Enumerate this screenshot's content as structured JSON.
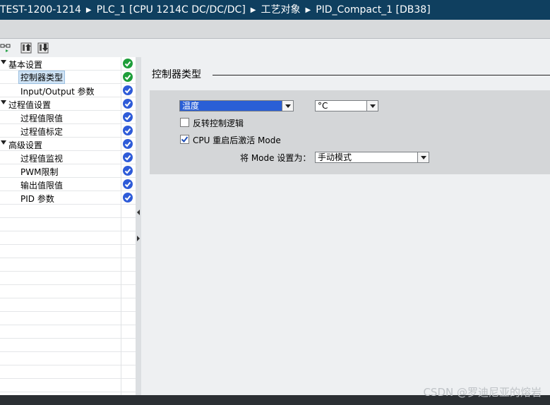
{
  "breadcrumb": [
    "TEST-1200-1214",
    "PLC_1 [CPU 1214C DC/DC/DC]",
    "工艺对象",
    "PID_Compact_1 [DB38]"
  ],
  "icons": {
    "toolbar": [
      "network-view-icon",
      "upload-icon",
      "download-icon"
    ]
  },
  "tree": [
    {
      "label": "基本设置",
      "level": 0,
      "status": "ok"
    },
    {
      "label": "控制器类型",
      "level": 1,
      "status": "ok",
      "selected": true
    },
    {
      "label": "Input/Output 参数",
      "level": 1,
      "status": "info"
    },
    {
      "label": "过程值设置",
      "level": 0,
      "status": "info"
    },
    {
      "label": "过程值限值",
      "level": 1,
      "status": "info"
    },
    {
      "label": "过程值标定",
      "level": 1,
      "status": "info"
    },
    {
      "label": "高级设置",
      "level": 0,
      "status": "info"
    },
    {
      "label": "过程值监视",
      "level": 1,
      "status": "info"
    },
    {
      "label": "PWM限制",
      "level": 1,
      "status": "info"
    },
    {
      "label": "输出值限值",
      "level": 1,
      "status": "info"
    },
    {
      "label": "PID 参数",
      "level": 1,
      "status": "info"
    }
  ],
  "section": {
    "title": "控制器类型"
  },
  "controller": {
    "type_value": "温度",
    "unit_value": "°C",
    "invert_label": "反转控制逻辑",
    "invert_checked": false,
    "restart_label": "CPU 重启后激活 Mode",
    "restart_checked": true,
    "mode_label": "将 Mode 设置为：",
    "mode_value": "手动模式"
  },
  "watermark": "CSDN @罗迪尼亚的熔岩",
  "colors": {
    "title_bg": "#0f3f5f",
    "ok": "#1e9e3a",
    "info": "#2e5bd8",
    "selected_combo": "#2a5fd6"
  }
}
